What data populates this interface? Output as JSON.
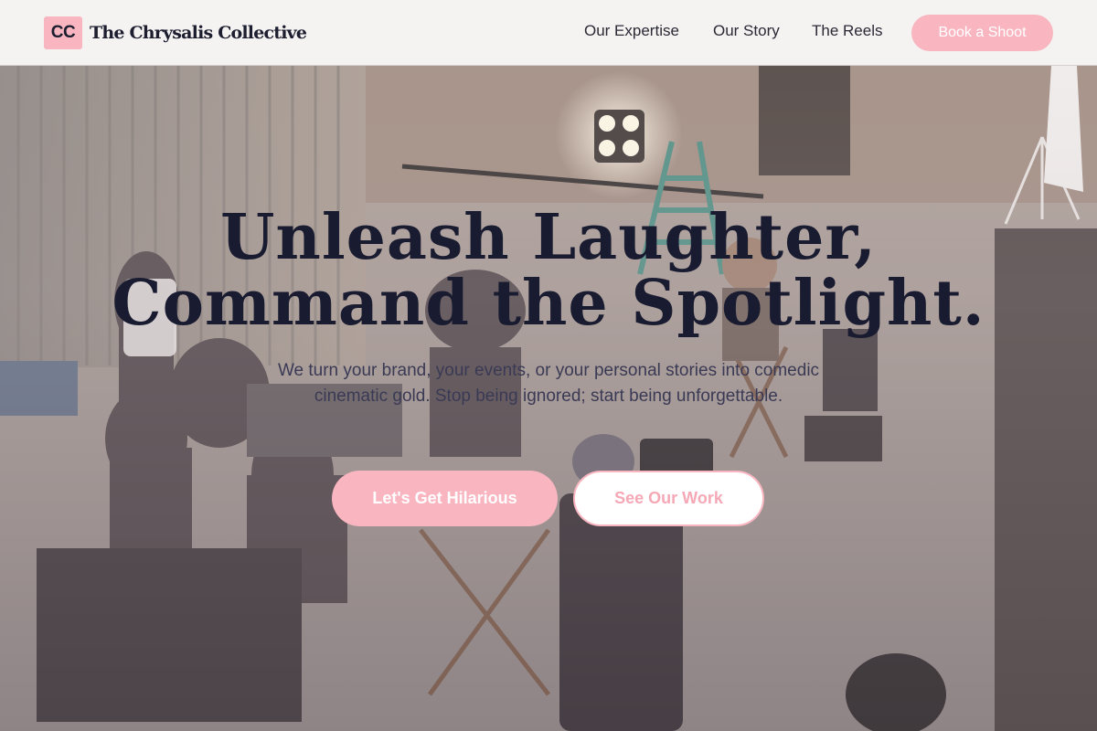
{
  "brand": {
    "mark": "CC",
    "name": "The Chrysalis Collective"
  },
  "nav": {
    "items": [
      {
        "label": "Our Expertise"
      },
      {
        "label": "Our Story"
      },
      {
        "label": "The Reels"
      }
    ],
    "cta_label": "Book a Shoot"
  },
  "hero": {
    "headline_line1": "Unleash Laughter,",
    "headline_line2": "Command the Spotlight.",
    "subtitle": "We turn your brand, your events, or your personal stories into comedic cinematic gold. Stop being ignored; start being unforgettable.",
    "primary_cta": "Let's Get Hilarious",
    "secondary_cta": "See Our Work",
    "background_image": "film-set-behind-the-scenes"
  },
  "colors": {
    "accent": "#f9b6c1",
    "headline": "#191b30",
    "body_text": "#3a3a55"
  }
}
